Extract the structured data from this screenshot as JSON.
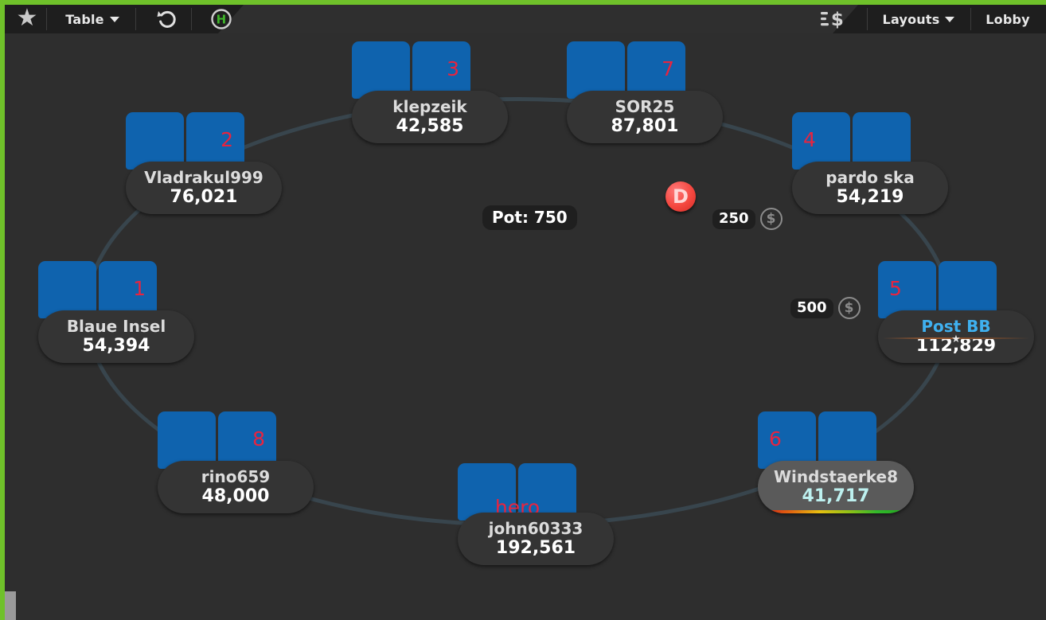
{
  "window": {
    "border_color": "#6fc12a",
    "felt_color": "#2e2e2e",
    "table_outline_color": "#3a4851"
  },
  "toolbar": {
    "star_icon": "star-icon",
    "table_label": "Table",
    "table_caret": "chevron-down-icon",
    "undo_icon": "undo-icon",
    "history_icon": "hand-history-icon",
    "history_letter": "H",
    "cash_icon": "cashier-icon",
    "layouts_label": "Layouts",
    "layouts_caret": "chevron-down-icon",
    "lobby_label": "Lobby"
  },
  "table": {
    "pot_label": "Pot: 750",
    "dealer_button": "D",
    "bets": [
      {
        "amount": "250",
        "chip": "$"
      },
      {
        "amount": "500",
        "chip": "$"
      }
    ]
  },
  "seats": [
    {
      "id": "klepzeik",
      "seat_number": "3",
      "number_side": "right",
      "name": "klepzeik",
      "stack": "42,585",
      "active": false,
      "name_highlight": false,
      "stack_cyan": false,
      "card_star": true,
      "plate_star": false,
      "timer": false,
      "hero": false
    },
    {
      "id": "sor25",
      "seat_number": "7",
      "number_side": "right",
      "name": "SOR25",
      "stack": "87,801",
      "active": false,
      "name_highlight": false,
      "stack_cyan": false,
      "card_star": false,
      "plate_star": false,
      "timer": false,
      "hero": false
    },
    {
      "id": "vladrakul999",
      "seat_number": "2",
      "number_side": "right",
      "name": "Vladrakul999",
      "stack": "76,021",
      "active": false,
      "name_highlight": false,
      "stack_cyan": false,
      "card_star": false,
      "plate_star": false,
      "timer": false,
      "hero": false
    },
    {
      "id": "pardo-ska",
      "seat_number": "4",
      "number_side": "left",
      "name": "pardo ska",
      "stack": "54,219",
      "active": false,
      "name_highlight": false,
      "stack_cyan": false,
      "card_star": false,
      "plate_star": false,
      "timer": false,
      "hero": false
    },
    {
      "id": "blaue-insel",
      "seat_number": "1",
      "number_side": "right",
      "name": "Blaue Insel",
      "stack": "54,394",
      "active": false,
      "name_highlight": false,
      "stack_cyan": false,
      "card_star": false,
      "plate_star": false,
      "timer": false,
      "hero": false
    },
    {
      "id": "post-bb",
      "seat_number": "5",
      "number_side": "left",
      "name": "Post BB",
      "stack": "112,829",
      "active": false,
      "name_highlight": true,
      "stack_cyan": false,
      "card_star": false,
      "plate_star": true,
      "timer": false,
      "hero": false
    },
    {
      "id": "rino659",
      "seat_number": "8",
      "number_side": "right",
      "name": "rino659",
      "stack": "48,000",
      "active": false,
      "name_highlight": false,
      "stack_cyan": false,
      "card_star": false,
      "plate_star": false,
      "timer": false,
      "hero": false
    },
    {
      "id": "windstaerke8",
      "seat_number": "6",
      "number_side": "left",
      "name": "Windstaerke8",
      "stack": "41,717",
      "active": true,
      "name_highlight": false,
      "stack_cyan": true,
      "card_star": false,
      "plate_star": false,
      "timer": true,
      "hero": false
    },
    {
      "id": "john60333",
      "seat_number": "hero",
      "number_side": "right",
      "name": "john60333",
      "stack": "192,561",
      "active": false,
      "name_highlight": false,
      "stack_cyan": false,
      "card_star": false,
      "plate_star": false,
      "timer": false,
      "hero": true
    }
  ]
}
